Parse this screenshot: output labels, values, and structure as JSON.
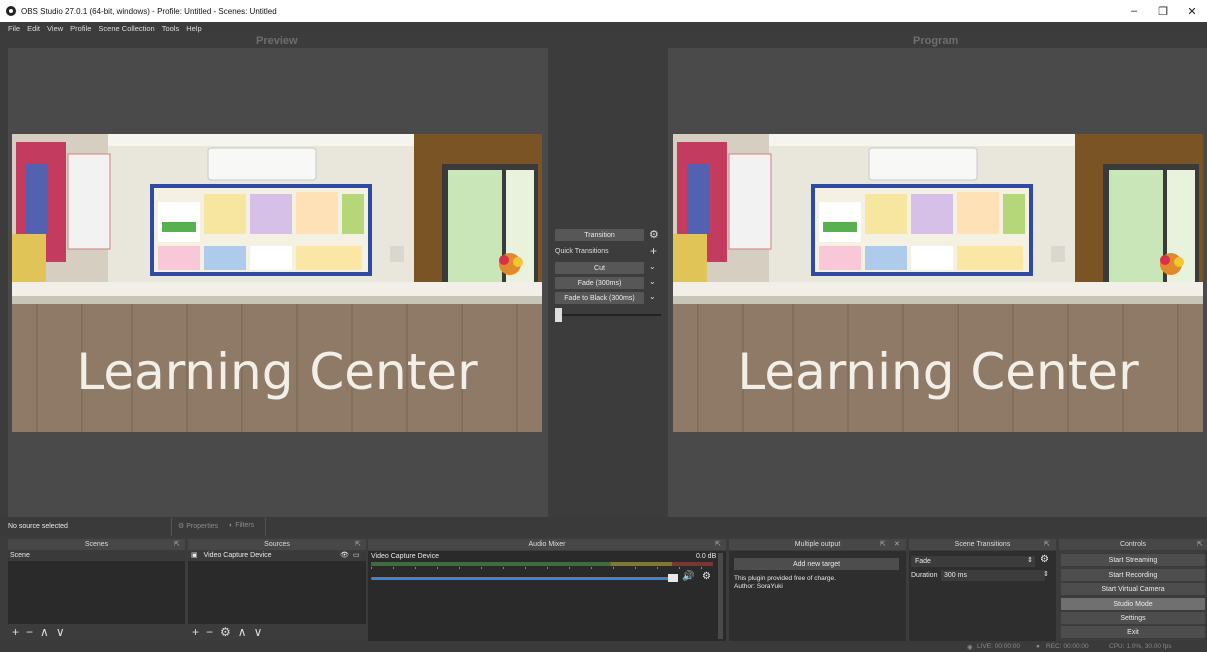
{
  "window": {
    "title": "OBS Studio 27.0.1 (64-bit, windows) - Profile: Untitled - Scenes: Untitled",
    "minimize": "–",
    "maximize": "❐",
    "close": "✕"
  },
  "menu": [
    "File",
    "Edit",
    "View",
    "Profile",
    "Scene Collection",
    "Tools",
    "Help"
  ],
  "preview": {
    "title": "Preview"
  },
  "program": {
    "title": "Program"
  },
  "scene_image": {
    "sign_text": "Learning Center"
  },
  "transitions": {
    "transition_button": "Transition",
    "quick_label": "Quick Transitions",
    "plus": "+",
    "items": [
      "Cut",
      "Fade (300ms)",
      "Fade to Black (300ms)"
    ]
  },
  "status": {
    "no_source": "No source selected",
    "properties": "Properties",
    "filters": "Filters"
  },
  "docks": {
    "scenes": {
      "title": "Scenes",
      "items": [
        "Scene"
      ]
    },
    "sources": {
      "title": "Sources",
      "items": [
        "Video Capture Device"
      ]
    },
    "audio_mixer": {
      "title": "Audio Mixer",
      "channel": "Video Capture Device",
      "level": "0.0 dB"
    },
    "multiple_output": {
      "title": "Multiple output",
      "add_target": "Add new target",
      "note_line1": "This plugin provided free of charge.",
      "note_line2": "Author: SoraYuki"
    },
    "scene_transitions": {
      "title": "Scene Transitions",
      "selected": "Fade",
      "duration_label": "Duration",
      "duration_value": "300 ms"
    },
    "controls": {
      "title": "Controls",
      "buttons": [
        "Start Streaming",
        "Start Recording",
        "Start Virtual Camera",
        "Studio Mode",
        "Settings",
        "Exit"
      ]
    }
  },
  "footer": {
    "live": "LIVE: 00:00:00",
    "rec": "REC: 00:00:00",
    "cpu": "CPU: 1.0%, 30.00 fps"
  }
}
